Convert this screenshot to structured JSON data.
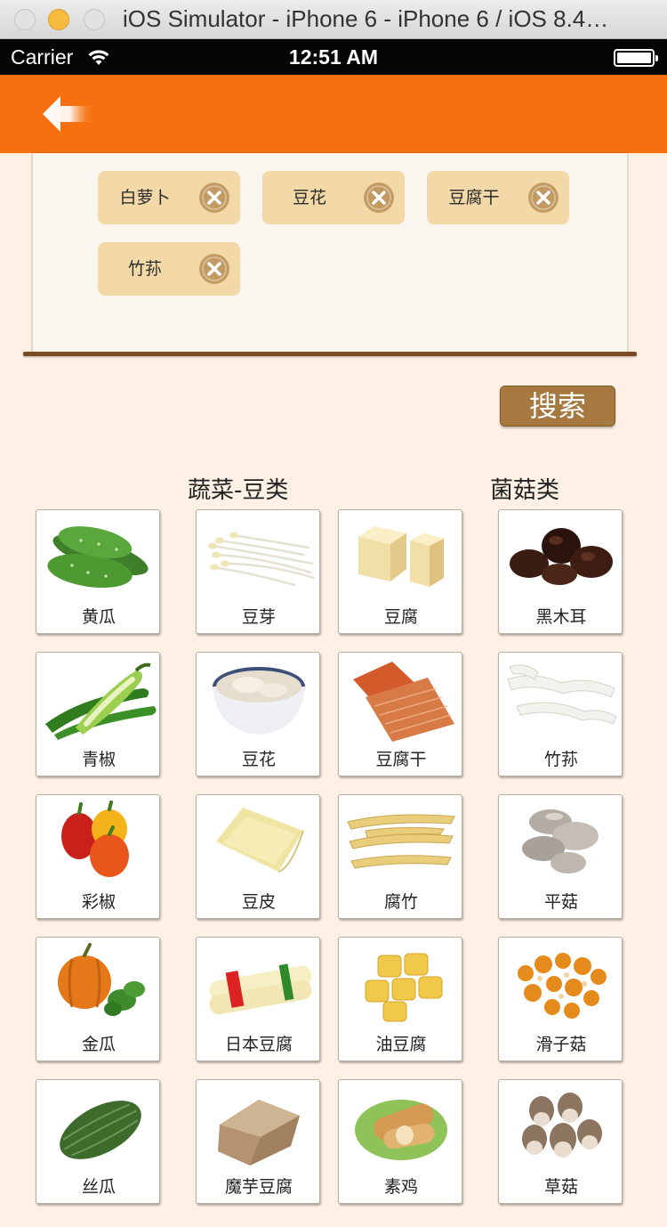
{
  "window": {
    "title": "iOS Simulator - iPhone 6 - iPhone 6 / iOS 8.4…"
  },
  "status_bar": {
    "carrier": "Carrier",
    "time": "12:51 AM"
  },
  "selected_tags": [
    {
      "label": "白萝卜"
    },
    {
      "label": "豆花"
    },
    {
      "label": "豆腐干"
    },
    {
      "label": "竹荪"
    }
  ],
  "search_button": {
    "label": "搜索"
  },
  "categories": [
    {
      "title": "蔬菜-豆类"
    },
    {
      "title": "菌菇类"
    }
  ],
  "foods": [
    [
      "黄瓜",
      "豆芽",
      "豆腐",
      "黑木耳"
    ],
    [
      "青椒",
      "豆花",
      "豆腐干",
      "竹荪"
    ],
    [
      "彩椒",
      "豆皮",
      "腐竹",
      "平菇"
    ],
    [
      "金瓜",
      "日本豆腐",
      "油豆腐",
      "滑子菇"
    ],
    [
      "丝瓜",
      "魔芋豆腐",
      "素鸡",
      "草菇"
    ]
  ],
  "colors": {
    "nav_bar": "#f6700f",
    "tag_bg": "#f3d8a8",
    "search_button": "#a57940",
    "page_bg": "#fcf1e4"
  },
  "icons": {
    "back": "back-arrow-icon",
    "remove": "close-circle-icon",
    "wifi": "wifi-icon",
    "battery": "battery-icon"
  }
}
